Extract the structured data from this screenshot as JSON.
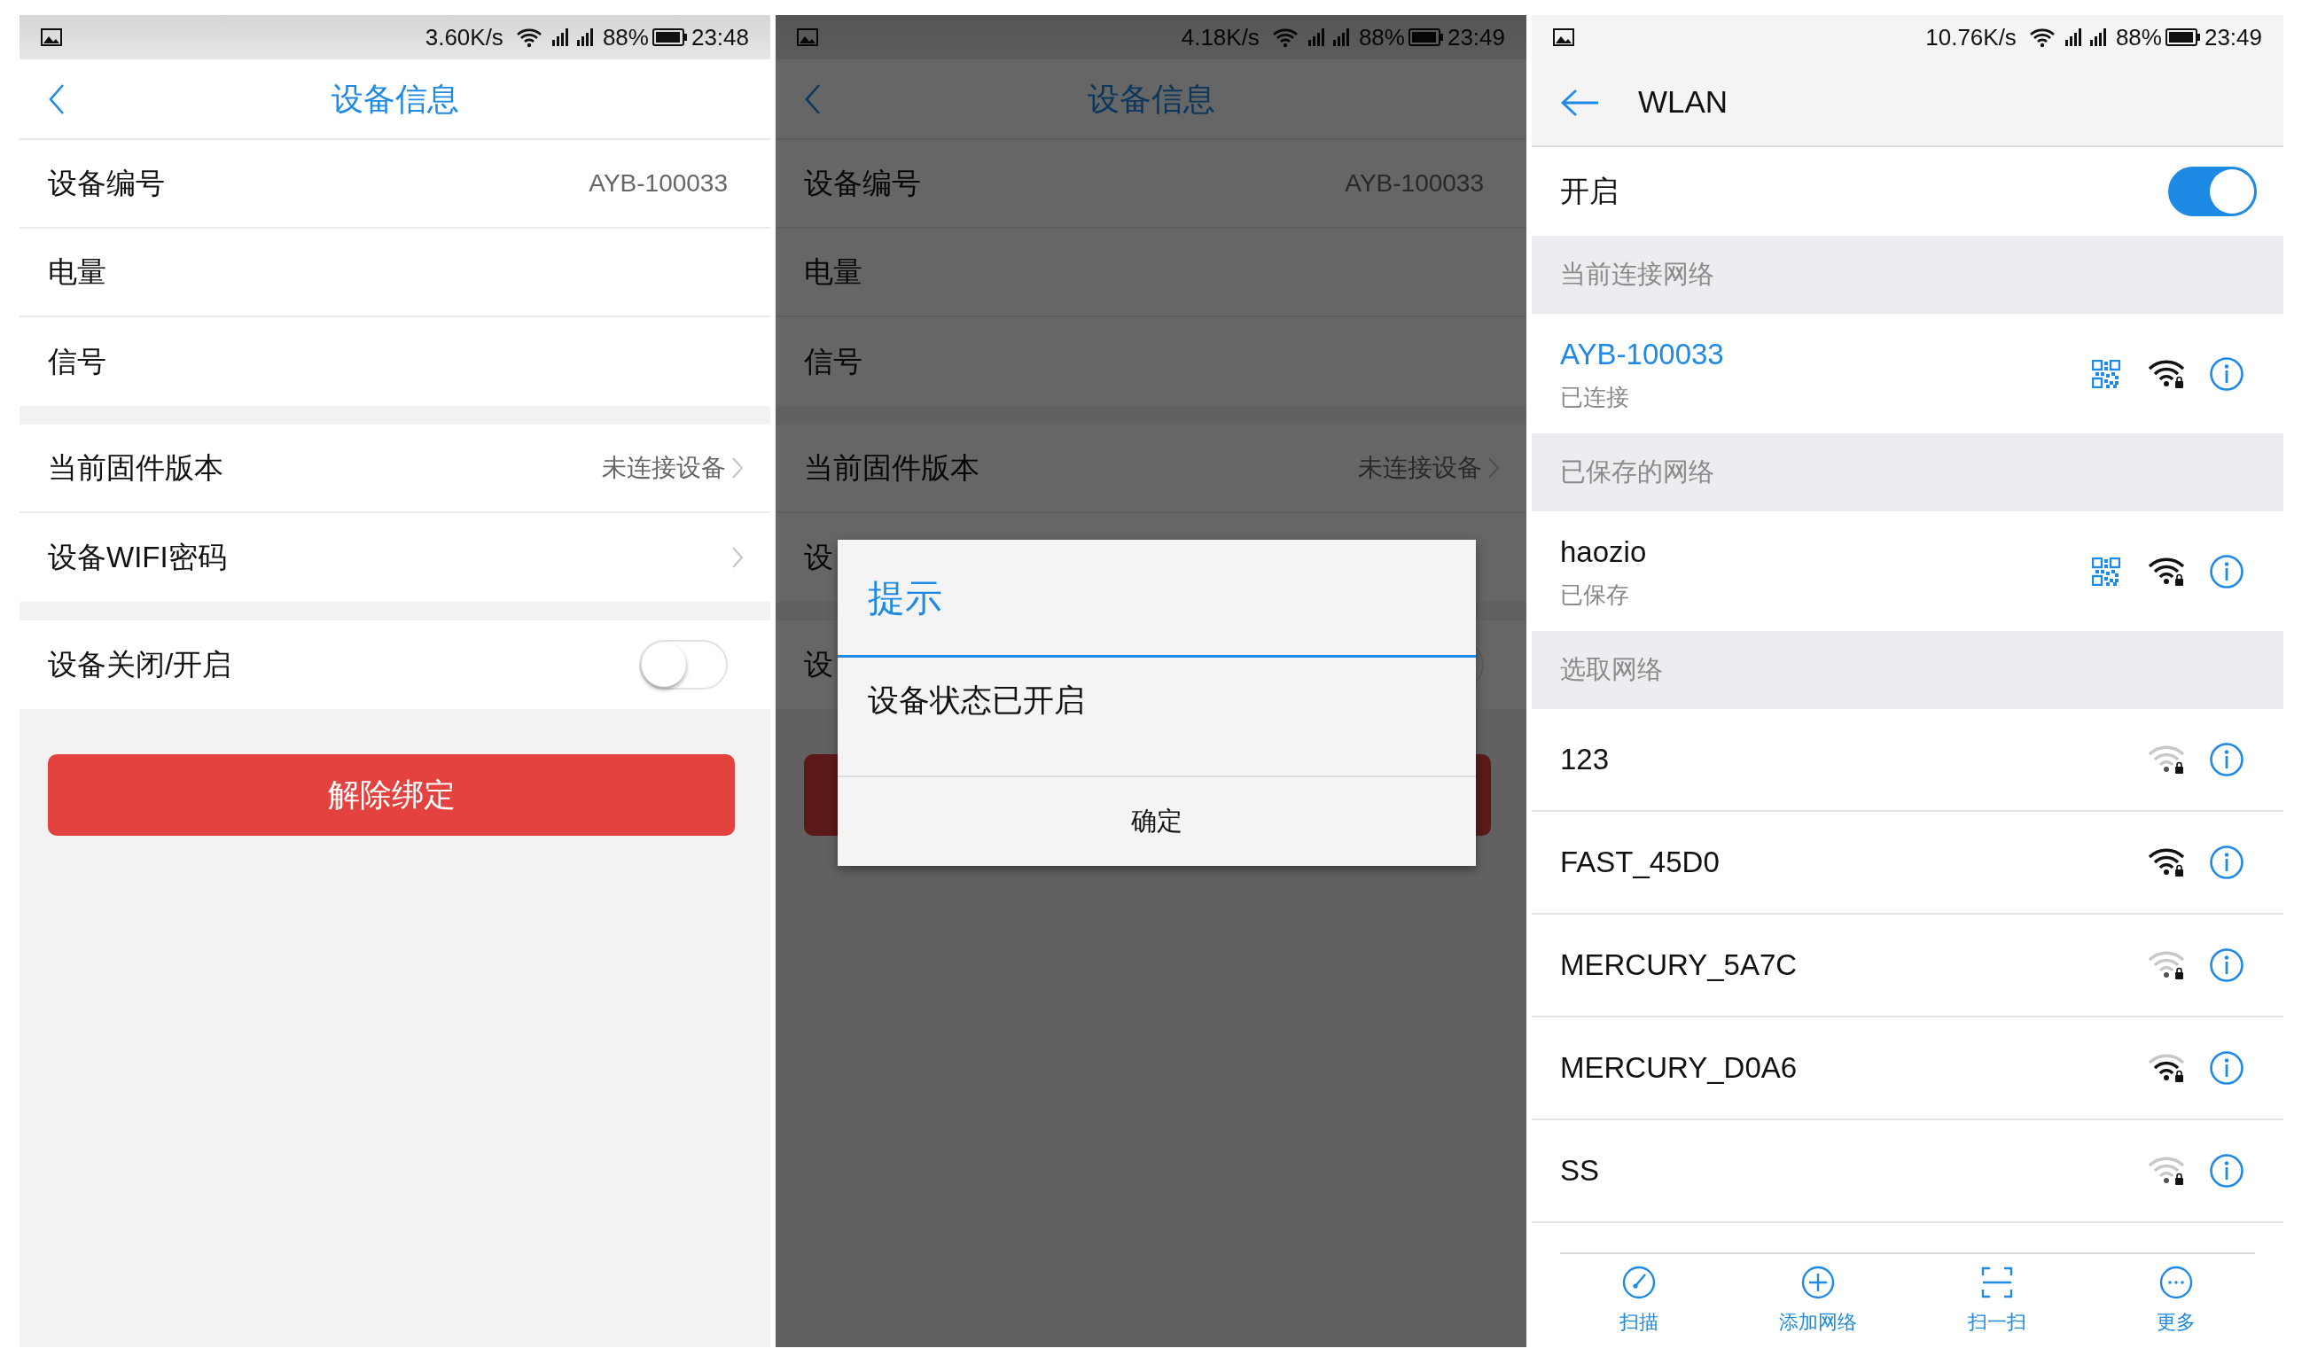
{
  "screens": [
    {
      "kind": "device",
      "status_bar": {
        "speed": "3.60K/s",
        "battery": "88%",
        "time": "23:48"
      },
      "title": "设备信息",
      "groups": [
        [
          {
            "label": "设备编号",
            "value": "AYB-100033",
            "chevron": false
          },
          {
            "label": "电量",
            "chevron": false
          },
          {
            "label": "信号",
            "chevron": false
          }
        ],
        [
          {
            "label": "当前固件版本",
            "value": "未连接设备",
            "chevron": true
          },
          {
            "label": "设备WIFI密码",
            "chevron": true
          }
        ],
        [
          {
            "label": "设备关闭/开启",
            "kind": "toggle",
            "on": false
          }
        ]
      ],
      "button": {
        "label": "解除绑定"
      }
    },
    {
      "kind": "device",
      "status_bar": {
        "speed": "4.18K/s",
        "battery": "88%",
        "time": "23:49"
      },
      "title": "设备信息",
      "groups": [
        [
          {
            "label": "设备编号",
            "value": "AYB-100033",
            "chevron": false
          },
          {
            "label": "电量",
            "chevron": false
          },
          {
            "label": "信号",
            "chevron": false
          }
        ],
        [
          {
            "label": "当前固件版本",
            "value": "未连接设备",
            "chevron": true
          },
          {
            "label": "设",
            "chevron": false
          }
        ],
        [
          {
            "label": "设",
            "kind": "toggle",
            "on": false
          }
        ]
      ],
      "button_label_covered": true,
      "dialog": {
        "title": "提示",
        "message": "设备状态已开启",
        "button": "确定"
      }
    },
    {
      "kind": "wlan",
      "status_bar": {
        "speed": "10.76K/s",
        "battery": "88%",
        "time": "23:49"
      },
      "title": "WLAN",
      "switch": {
        "label": "开启",
        "on": true
      },
      "sections": [
        {
          "title": "当前连接网络",
          "networks": [
            {
              "name": "AYB-100033",
              "status": "已连接",
              "connected": true,
              "qr": true,
              "kind": "strong"
            }
          ]
        },
        {
          "title": "已保存的网络",
          "networks": [
            {
              "name": "haozio",
              "status": "已保存",
              "connected": false,
              "qr": true,
              "kind": "strong"
            }
          ]
        },
        {
          "title": "选取网络",
          "networks": [
            {
              "name": "123",
              "connected": false,
              "qr": false,
              "kind": "weak"
            },
            {
              "name": "FAST_45D0",
              "connected": false,
              "qr": false,
              "kind": "strong"
            },
            {
              "name": "MERCURY_5A7C",
              "connected": false,
              "qr": false,
              "kind": "weak"
            },
            {
              "name": "MERCURY_D0A6",
              "connected": false,
              "qr": false,
              "kind": "medium"
            },
            {
              "name": "SS",
              "connected": false,
              "qr": false,
              "kind": "weak"
            }
          ]
        }
      ],
      "bottom_nav": [
        {
          "label": "扫描"
        },
        {
          "label": "添加网络"
        },
        {
          "label": "扫一扫"
        },
        {
          "label": "更多"
        }
      ]
    }
  ]
}
